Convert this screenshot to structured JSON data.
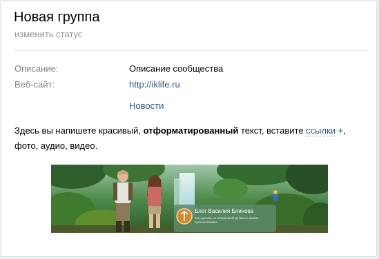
{
  "group": {
    "title": "Новая группа",
    "status_link": "изменить статус"
  },
  "info": {
    "description_label": "Описание:",
    "description_value": "Описание сообщества",
    "website_label": "Веб-сайт:",
    "website_value": "http://iklife.ru",
    "news_link": "Новости"
  },
  "text": {
    "part1": "Здесь вы напишете красивый, ",
    "bold": "отформатированный",
    "part2": " текст, вставите ",
    "link": "ссылки",
    "plus": " +",
    "part3": ", фото, аудио, видео."
  },
  "banner": {
    "title": "Блог Василия Блинова",
    "subtitle": "Как сделать из ежедневной рутины и начать путешествовать"
  },
  "colors": {
    "link": "#2a5885",
    "muted": "#828282",
    "status": "#939393",
    "background": "#edeef0"
  }
}
